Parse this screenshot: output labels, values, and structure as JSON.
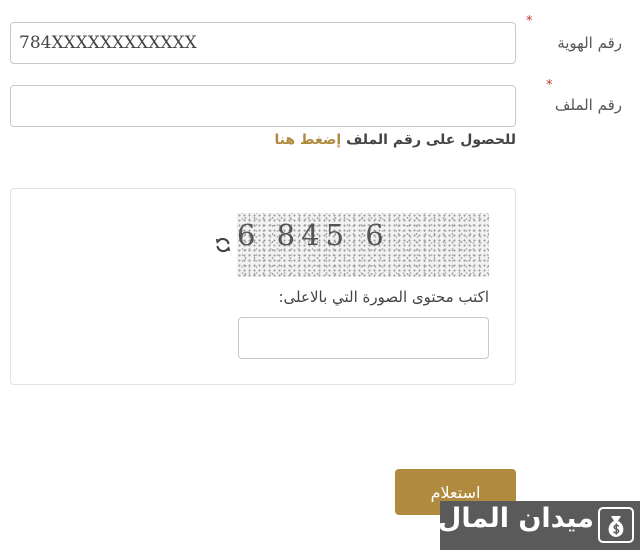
{
  "form": {
    "id_number": {
      "label": "رقم الهوية",
      "required_marker": "*",
      "value": "784XXXXXXXXXXXX"
    },
    "file_number": {
      "label": "رقم الملف",
      "required_marker": "*",
      "value": ""
    },
    "help": {
      "text": "للحصول على رقم الملف",
      "link_label": "إضغط هنا"
    },
    "captcha": {
      "image_text": "6 845 6",
      "refresh_icon": "refresh-icon",
      "label": "اكتب محتوى الصورة التي بالاعلى:",
      "value": ""
    },
    "submit_label": "استعلام"
  },
  "watermark": {
    "text": "ميدان المال",
    "logo_icon": "money-bag-icon"
  },
  "colors": {
    "accent": "#b08a3e",
    "required": "#c0392b",
    "border": "#c8c8c8",
    "watermark_bg": "#5a5a5a"
  }
}
